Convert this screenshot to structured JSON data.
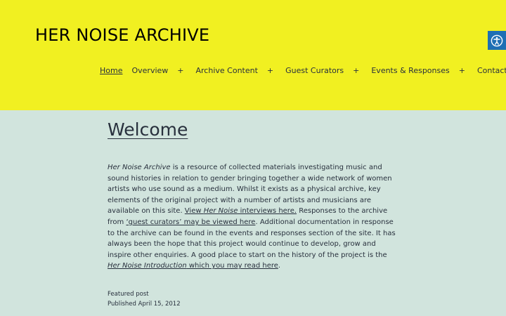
{
  "site": {
    "title": "HER NOISE ARCHIVE"
  },
  "nav": {
    "home": "Home",
    "items": [
      {
        "label": "Overview",
        "toggle": "+"
      },
      {
        "label": "Archive Content",
        "toggle": "+"
      },
      {
        "label": "Guest Curators",
        "toggle": "+"
      },
      {
        "label": "Events & Responses",
        "toggle": "+"
      },
      {
        "label": "Contact",
        "toggle": "+"
      }
    ]
  },
  "post": {
    "title": "Welcome",
    "body": {
      "em1": "Her Noise Archive",
      "t1": " is a resource of collected materials investigating music and sound histories in relation to gender bringing together a wide network of women artists who use sound as a medium. Whilst it exists as a physical archive, key elements of the original project with a number of artists and musicians are available on this site. ",
      "link1_a": "View ",
      "link1_em": "Her Noise",
      "link1_b": " interviews here.",
      "t2": " Responses to the archive from ",
      "link2": "‘guest curators’ may be viewed here",
      "t3": ". Additional documentation in response to the archive can be found in the events and responses section of the site. It has always been the hope that this project would continue to develop, grow and inspire other enquiries. A good place to start on the history of the project is the ",
      "link3_em": "Her Noise Introduction",
      "link3_b": " which you may read here",
      "t4": "."
    },
    "meta": {
      "featured": "Featured post",
      "published": "Published April 15, 2012"
    }
  },
  "icons": {
    "accessibility": "accessibility-icon"
  },
  "colors": {
    "header_bg": "#f1f021",
    "page_bg": "#d1e4dd",
    "accessibility_bg": "#1e6fb4",
    "text": "#28303d"
  }
}
